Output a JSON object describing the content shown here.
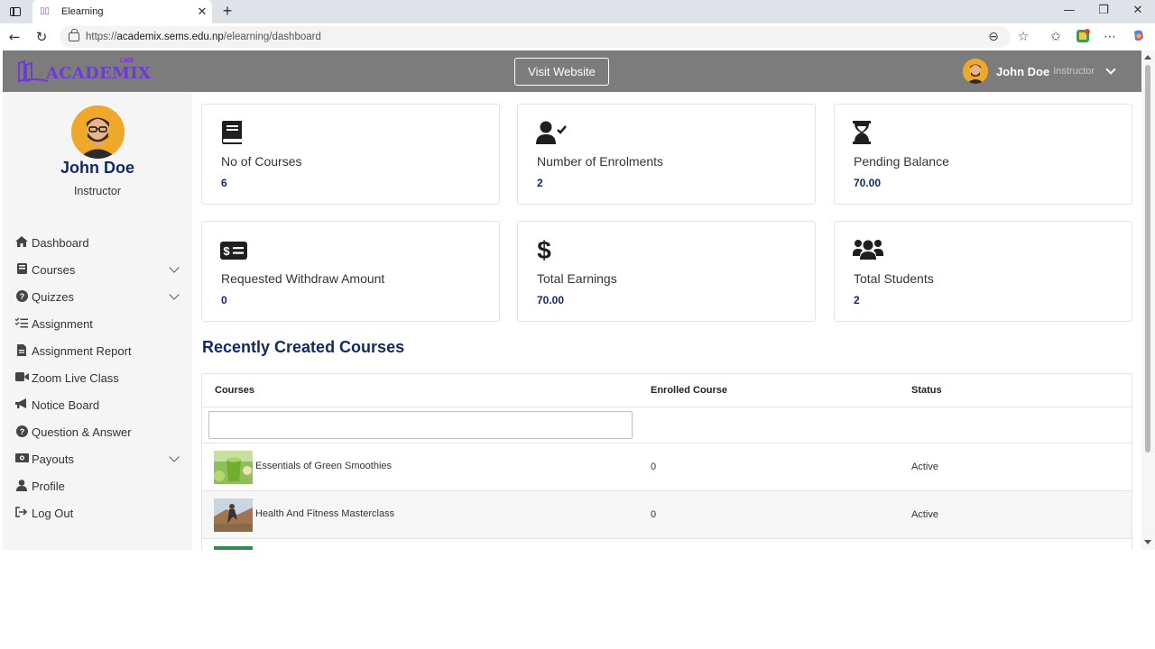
{
  "browser": {
    "tab_title": "Elearning",
    "url_prefix": "https://",
    "url_domain": "academix.sems.edu.np",
    "url_path": "/elearning/dashboard"
  },
  "header": {
    "logo_text": "ACADEMIX",
    "logo_sup": "LMS",
    "visit_button": "Visit Website",
    "user_name": "John Doe",
    "user_role": "Instructor"
  },
  "sidebar": {
    "name": "John Doe",
    "role": "Instructor",
    "items": [
      {
        "label": "Dashboard",
        "icon": "home-icon",
        "expandable": false
      },
      {
        "label": "Courses",
        "icon": "book-icon",
        "expandable": true
      },
      {
        "label": "Quizzes",
        "icon": "question-circle-icon",
        "expandable": true
      },
      {
        "label": "Assignment",
        "icon": "checklist-icon",
        "expandable": false
      },
      {
        "label": "Assignment Report",
        "icon": "file-icon",
        "expandable": false
      },
      {
        "label": "Zoom Live Class",
        "icon": "video-icon",
        "expandable": false
      },
      {
        "label": "Notice Board",
        "icon": "bullhorn-icon",
        "expandable": false
      },
      {
        "label": "Question & Answer",
        "icon": "question-circle-icon",
        "expandable": false
      },
      {
        "label": "Payouts",
        "icon": "money-icon",
        "expandable": true
      },
      {
        "label": "Profile",
        "icon": "user-icon",
        "expandable": false
      },
      {
        "label": "Log Out",
        "icon": "logout-icon",
        "expandable": false
      }
    ]
  },
  "stats": [
    {
      "label": "No of Courses",
      "value": "6",
      "icon": "book-icon"
    },
    {
      "label": "Number of Enrolments",
      "value": "2",
      "icon": "user-check-icon"
    },
    {
      "label": "Pending Balance",
      "value": "70.00",
      "icon": "hourglass-icon"
    },
    {
      "label": "Requested Withdraw Amount",
      "value": "0",
      "icon": "money-check-icon"
    },
    {
      "label": "Total Earnings",
      "value": "70.00",
      "icon": "dollar-icon"
    },
    {
      "label": "Total Students",
      "value": "2",
      "icon": "users-icon"
    }
  ],
  "recent": {
    "title": "Recently Created Courses",
    "columns": [
      "Courses",
      "Enrolled Course",
      "Status"
    ],
    "filter_value": "",
    "rows": [
      {
        "course": "Essentials of Green Smoothies",
        "enrolled": "0",
        "status": "Active"
      },
      {
        "course": "Health And Fitness Masterclass",
        "enrolled": "0",
        "status": "Active"
      }
    ]
  },
  "colors": {
    "header_bg": "#7c7c7c",
    "brand_purple": "#6f3bd6",
    "accent_navy": "#112a66",
    "sidebar_bg": "#f5f5f5"
  }
}
